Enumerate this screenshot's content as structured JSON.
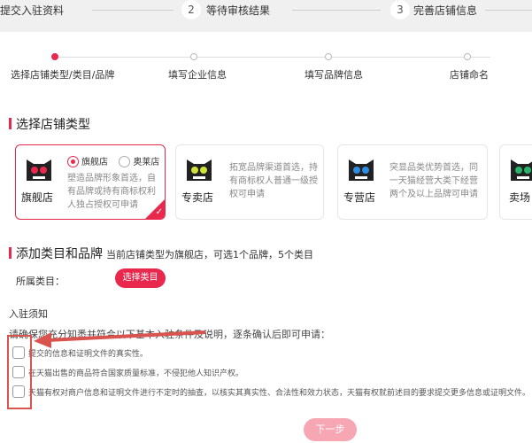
{
  "steps": [
    {
      "num": "",
      "label": "提交入驻资料"
    },
    {
      "num": "2",
      "label": "等待审核结果"
    },
    {
      "num": "3",
      "label": "完善店铺信息"
    }
  ],
  "progress": [
    "选择店铺类型/类目/品牌",
    "填写企业信息",
    "填写品牌信息",
    "店铺命名"
  ],
  "section1_title": "选择店铺类型",
  "cards": [
    {
      "name": "旗舰店",
      "radio1": "旗舰店",
      "radio2": "奥莱店",
      "desc": "塑造品牌形象首选，自有品牌或持有商标权利人独占授权可申请",
      "cat_color": "#e8284c"
    },
    {
      "name": "专卖店",
      "desc": "拓宽品牌渠道首选，持有商标权人普通一级授权可申请",
      "cat_color": "#cfe23a"
    },
    {
      "name": "专营店",
      "desc": "突显品类优势首选，同一天猫经营大类下经营两个及以上品牌可申请",
      "cat_color": "#2f8ce6"
    },
    {
      "name": "卖场",
      "cat_color": "#29b36b"
    }
  ],
  "section2_title": "添加类目和品牌",
  "section2_hint": "当前店铺类型为旗舰店，可选1个品牌，5个类目",
  "category_label": "所属类目：",
  "select_category_button": "选择类目",
  "notice_title": "入驻须知",
  "notice_line": "请确保您充分知悉并符合以下基本入驻条件及说明，逐条确认后即可申请：",
  "agreements": [
    "提交的信息和证明文件的真实性。",
    "在天猫出售的商品符合国家质量标准，不侵犯他人知识产权。",
    "天猫有权对商户信息和证明文件进行不定时的抽查，以核实其真实性、合法性和效力状态，天猫有权就前述目的要求提交更多信息或证明文件。"
  ],
  "next_button": "下一步",
  "colors": {
    "accent": "#e8284c",
    "highlight": "#d9534f"
  }
}
